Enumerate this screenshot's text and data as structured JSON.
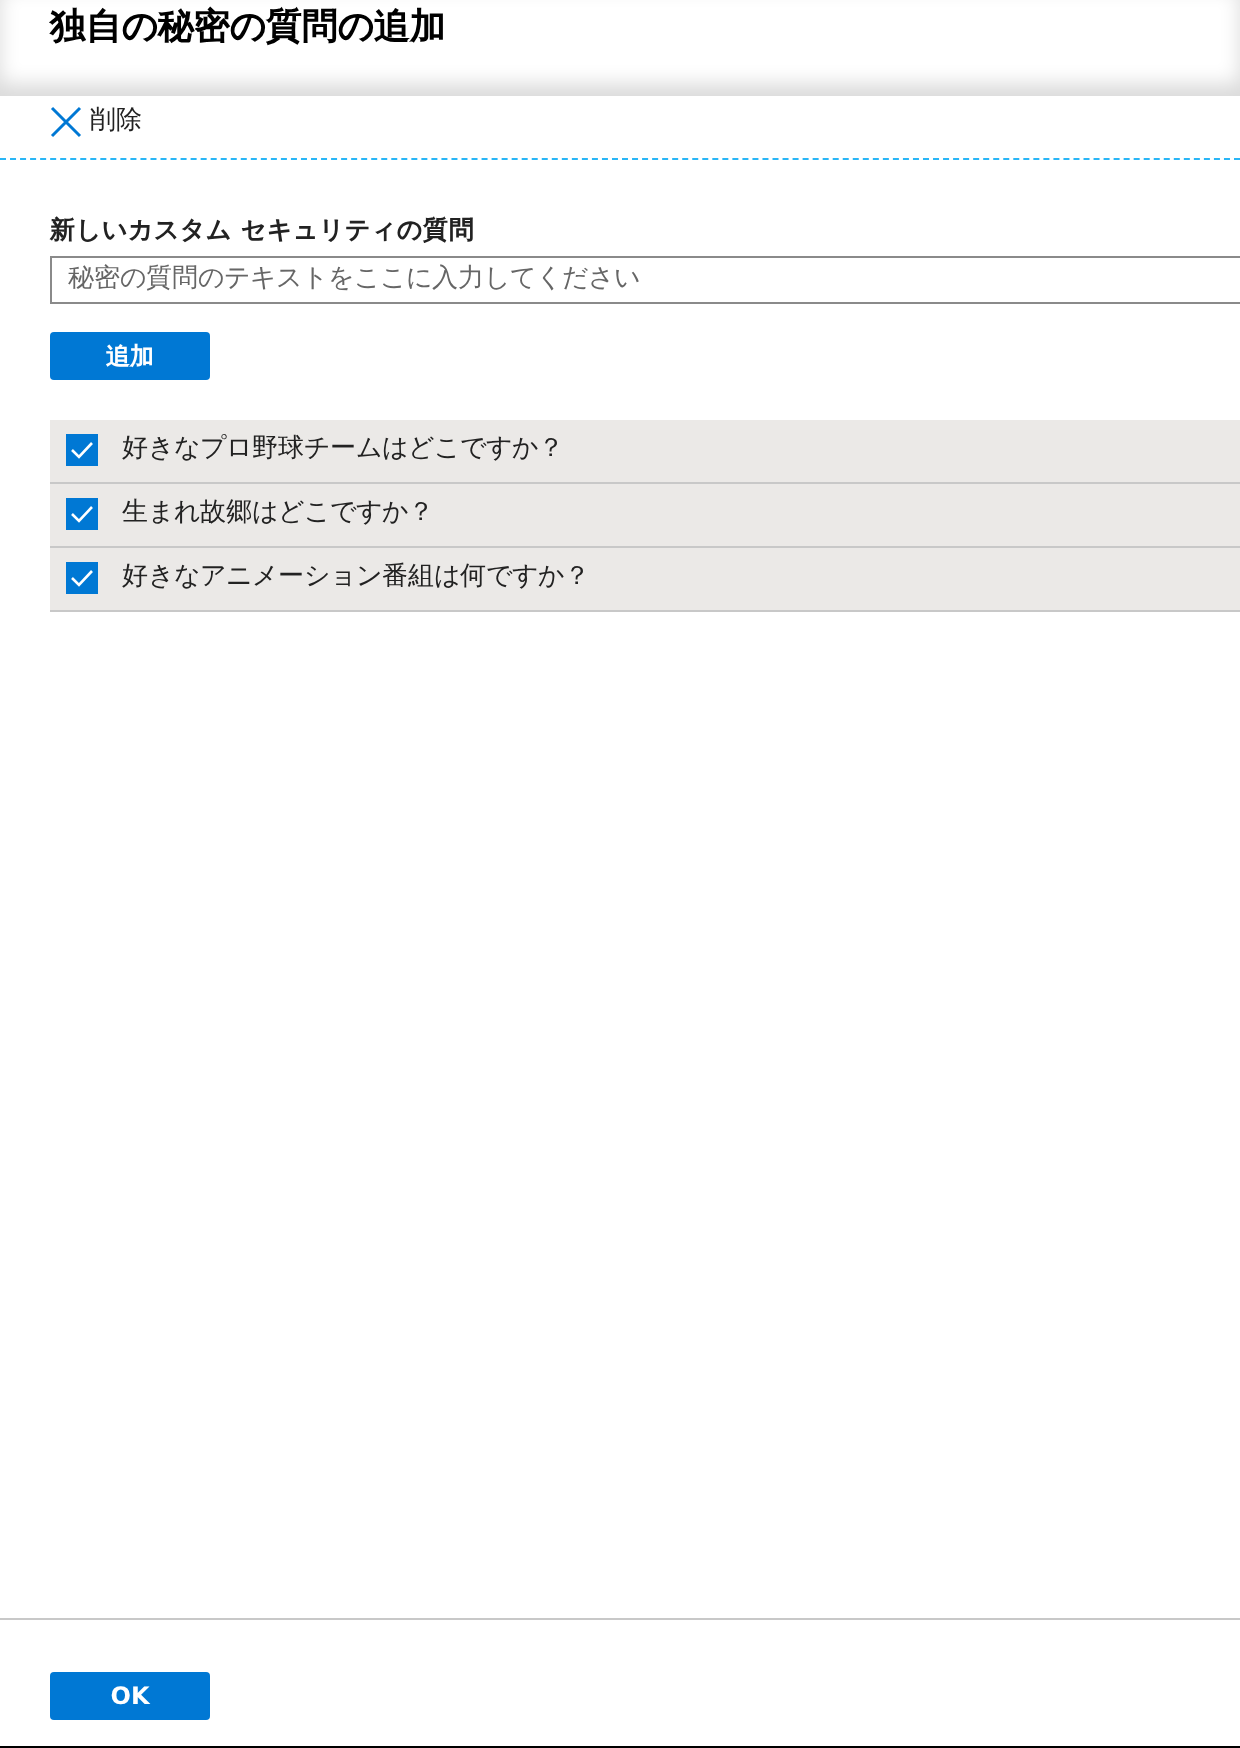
{
  "title": "独自の秘密の質問の追加",
  "toolbar": {
    "delete_label": "削除"
  },
  "new_question": {
    "label": "新しいカスタム セキュリティの質問",
    "placeholder": "秘密の質問のテキストをここに入力してください"
  },
  "add_button": "追加",
  "questions": [
    {
      "text": "好きなプロ野球チームはどこですか？",
      "checked": true
    },
    {
      "text": "生まれ故郷はどこですか？",
      "checked": true
    },
    {
      "text": "好きなアニメーション番組は何ですか？",
      "checked": true
    }
  ],
  "ok_button": "OK"
}
